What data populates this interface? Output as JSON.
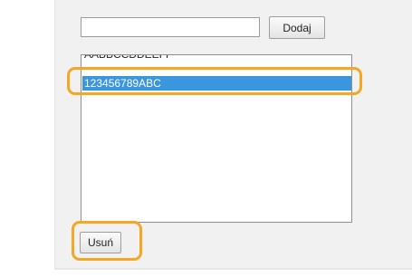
{
  "form": {
    "text_value": "",
    "add_label": "Dodaj"
  },
  "list": {
    "items": [
      {
        "label": "AABBCCDDEEFF"
      },
      {
        "label": "123456789ABC",
        "selected": true
      }
    ]
  },
  "actions": {
    "remove_label": "Usuń"
  },
  "colors": {
    "highlight": "#f5a623",
    "selection": "#3a96dd",
    "panel": "#f1f1f1"
  }
}
